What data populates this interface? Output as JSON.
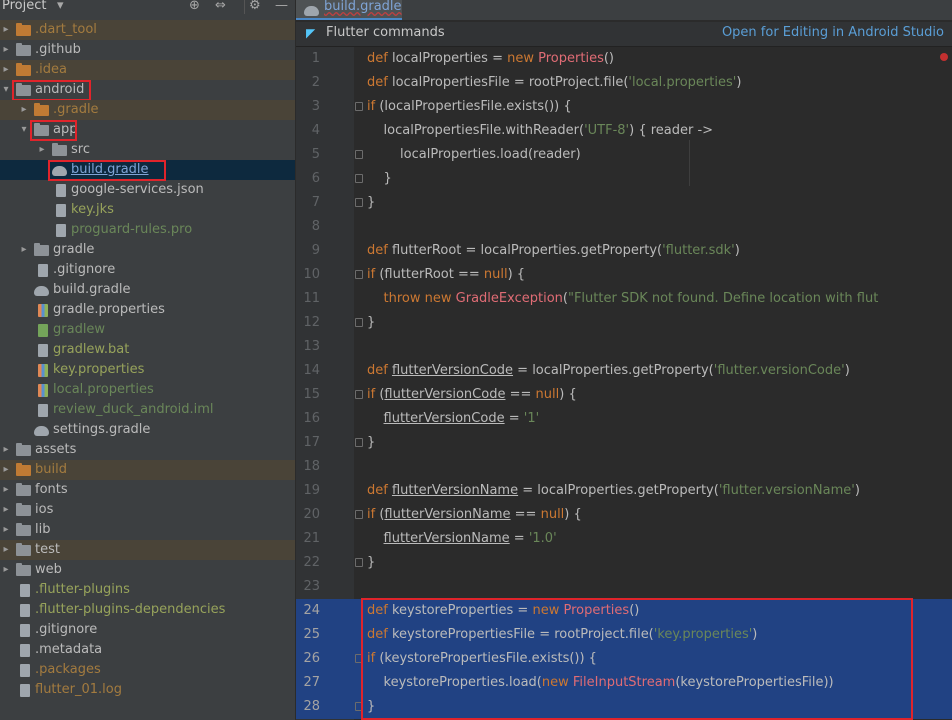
{
  "project_panel": {
    "title": "Project",
    "tree": [
      {
        "label": ".dart_tool",
        "kind": "folder",
        "arrow": true,
        "indent": 0,
        "color": "orange",
        "bg": "ignored"
      },
      {
        "label": ".github",
        "kind": "folder",
        "arrow": true,
        "indent": 0,
        "color": "default"
      },
      {
        "label": ".idea",
        "kind": "folder",
        "arrow": true,
        "indent": 0,
        "color": "orange",
        "bg": "ignored"
      },
      {
        "label": "android",
        "kind": "folder",
        "arrow": true,
        "expanded": true,
        "indent": 0,
        "color": "default",
        "boxed": true
      },
      {
        "label": ".gradle",
        "kind": "folder",
        "arrow": true,
        "indent": 1,
        "color": "orange",
        "bg": "ignored"
      },
      {
        "label": "app",
        "kind": "folder",
        "arrow": true,
        "expanded": true,
        "indent": 1,
        "color": "default",
        "boxed": true
      },
      {
        "label": "src",
        "kind": "folder",
        "arrow": true,
        "indent": 2,
        "color": "default"
      },
      {
        "label": "build.gradle",
        "kind": "gradle",
        "indent": 2,
        "color": "link",
        "selected": true,
        "boxed": true
      },
      {
        "label": "google-services.json",
        "kind": "file",
        "indent": 2,
        "color": "default"
      },
      {
        "label": "key.jks",
        "kind": "file",
        "indent": 2,
        "color": "olive"
      },
      {
        "label": "proguard-rules.pro",
        "kind": "file",
        "indent": 2,
        "color": "green"
      },
      {
        "label": "gradle",
        "kind": "folder",
        "arrow": true,
        "indent": 1,
        "color": "default"
      },
      {
        "label": ".gitignore",
        "kind": "file",
        "indent": 1,
        "color": "default"
      },
      {
        "label": "build.gradle",
        "kind": "gradle",
        "indent": 1,
        "color": "default"
      },
      {
        "label": "gradle.properties",
        "kind": "file-bar",
        "indent": 1,
        "color": "default"
      },
      {
        "label": "gradlew",
        "kind": "file-green",
        "indent": 1,
        "color": "green"
      },
      {
        "label": "gradlew.bat",
        "kind": "file",
        "indent": 1,
        "color": "olive"
      },
      {
        "label": "key.properties",
        "kind": "file-bar",
        "indent": 1,
        "color": "olive"
      },
      {
        "label": "local.properties",
        "kind": "file-bar",
        "indent": 1,
        "color": "green"
      },
      {
        "label": "review_duck_android.iml",
        "kind": "file",
        "indent": 1,
        "color": "green"
      },
      {
        "label": "settings.gradle",
        "kind": "gradle",
        "indent": 1,
        "color": "default"
      },
      {
        "label": "assets",
        "kind": "folder",
        "arrow": true,
        "indent": 0,
        "color": "default"
      },
      {
        "label": "build",
        "kind": "folder-orange",
        "arrow": true,
        "indent": 0,
        "color": "orange",
        "bg": "ignored"
      },
      {
        "label": "fonts",
        "kind": "folder",
        "arrow": true,
        "indent": 0,
        "color": "default"
      },
      {
        "label": "ios",
        "kind": "folder",
        "arrow": true,
        "indent": 0,
        "color": "default"
      },
      {
        "label": "lib",
        "kind": "folder",
        "arrow": true,
        "indent": 0,
        "color": "default"
      },
      {
        "label": "test",
        "kind": "folder",
        "arrow": true,
        "indent": 0,
        "color": "default",
        "bg": "ignored"
      },
      {
        "label": "web",
        "kind": "folder",
        "arrow": true,
        "indent": 0,
        "color": "default"
      },
      {
        "label": ".flutter-plugins",
        "kind": "file",
        "indent": 0,
        "color": "olive"
      },
      {
        "label": ".flutter-plugins-dependencies",
        "kind": "file",
        "indent": 0,
        "color": "olive"
      },
      {
        "label": ".gitignore",
        "kind": "file",
        "indent": 0,
        "color": "default"
      },
      {
        "label": ".metadata",
        "kind": "file",
        "indent": 0,
        "color": "default"
      },
      {
        "label": ".packages",
        "kind": "file",
        "indent": 0,
        "color": "orange"
      },
      {
        "label": "flutter_01.log",
        "kind": "file",
        "indent": 0,
        "color": "orange"
      }
    ]
  },
  "editor": {
    "tab_label": "build.gradle",
    "flutter_bar": {
      "label": "Flutter commands",
      "action": "Open for Editing in Android Studio"
    },
    "lines": [
      {
        "n": "1",
        "fold": false,
        "tokens": [
          [
            "kw",
            "def "
          ],
          [
            "plain",
            "localProperties = "
          ],
          [
            "kw",
            "new "
          ],
          [
            "cls",
            "Properties"
          ],
          [
            "plain",
            "()"
          ]
        ]
      },
      {
        "n": "2",
        "fold": false,
        "tokens": [
          [
            "kw",
            "def "
          ],
          [
            "plain",
            "localPropertiesFile = rootProject.file("
          ],
          [
            "str",
            "'local.properties'"
          ],
          [
            "plain",
            ")"
          ]
        ]
      },
      {
        "n": "3",
        "fold": true,
        "tokens": [
          [
            "kw",
            "if "
          ],
          [
            "plain",
            "(localPropertiesFile.exists()) {"
          ]
        ]
      },
      {
        "n": "4",
        "fold": false,
        "tokens": [
          [
            "plain",
            "    localPropertiesFile.withReader("
          ],
          [
            "str",
            "'UTF-8'"
          ],
          [
            "plain",
            ") { reader ->"
          ]
        ]
      },
      {
        "n": "5",
        "fold": true,
        "tokens": [
          [
            "plain",
            "        localProperties.load(reader)"
          ]
        ]
      },
      {
        "n": "6",
        "fold": true,
        "tokens": [
          [
            "plain",
            "    }"
          ]
        ]
      },
      {
        "n": "7",
        "fold": true,
        "tokens": [
          [
            "plain",
            "}"
          ]
        ]
      },
      {
        "n": "8",
        "fold": false,
        "tokens": []
      },
      {
        "n": "9",
        "fold": false,
        "tokens": [
          [
            "kw",
            "def "
          ],
          [
            "plain",
            "flutterRoot = localProperties.getProperty("
          ],
          [
            "str",
            "'flutter.sdk'"
          ],
          [
            "plain",
            ")"
          ]
        ]
      },
      {
        "n": "10",
        "fold": true,
        "tokens": [
          [
            "kw",
            "if "
          ],
          [
            "plain",
            "(flutterRoot == "
          ],
          [
            "kw",
            "null"
          ],
          [
            "plain",
            ") {"
          ]
        ]
      },
      {
        "n": "11",
        "fold": false,
        "tokens": [
          [
            "plain",
            "    "
          ],
          [
            "kw",
            "throw new "
          ],
          [
            "cls",
            "GradleException"
          ],
          [
            "plain",
            "("
          ],
          [
            "dstr",
            "\"Flutter SDK not found. Define location with flut"
          ]
        ]
      },
      {
        "n": "12",
        "fold": true,
        "tokens": [
          [
            "plain",
            "}"
          ]
        ]
      },
      {
        "n": "13",
        "fold": false,
        "tokens": []
      },
      {
        "n": "14",
        "fold": false,
        "tokens": [
          [
            "kw",
            "def "
          ],
          [
            "prop",
            "flutterVersionCode"
          ],
          [
            "plain",
            " = localProperties.getProperty("
          ],
          [
            "str",
            "'flutter.versionCode'"
          ],
          [
            "plain",
            ")"
          ]
        ]
      },
      {
        "n": "15",
        "fold": true,
        "tokens": [
          [
            "kw",
            "if "
          ],
          [
            "plain",
            "("
          ],
          [
            "prop",
            "flutterVersionCode"
          ],
          [
            "plain",
            " == "
          ],
          [
            "kw",
            "null"
          ],
          [
            "plain",
            ") {"
          ]
        ]
      },
      {
        "n": "16",
        "fold": false,
        "tokens": [
          [
            "plain",
            "    "
          ],
          [
            "prop",
            "flutterVersionCode"
          ],
          [
            "plain",
            " = "
          ],
          [
            "str",
            "'1'"
          ]
        ]
      },
      {
        "n": "17",
        "fold": true,
        "tokens": [
          [
            "plain",
            "}"
          ]
        ]
      },
      {
        "n": "18",
        "fold": false,
        "tokens": []
      },
      {
        "n": "19",
        "fold": false,
        "tokens": [
          [
            "kw",
            "def "
          ],
          [
            "prop",
            "flutterVersionName"
          ],
          [
            "plain",
            " = localProperties.getProperty("
          ],
          [
            "str",
            "'flutter.versionName'"
          ],
          [
            "plain",
            ")"
          ]
        ]
      },
      {
        "n": "20",
        "fold": true,
        "tokens": [
          [
            "kw",
            "if "
          ],
          [
            "plain",
            "("
          ],
          [
            "prop",
            "flutterVersionName"
          ],
          [
            "plain",
            " == "
          ],
          [
            "kw",
            "null"
          ],
          [
            "plain",
            ") {"
          ]
        ]
      },
      {
        "n": "21",
        "fold": false,
        "tokens": [
          [
            "plain",
            "    "
          ],
          [
            "prop",
            "flutterVersionName"
          ],
          [
            "plain",
            " = "
          ],
          [
            "str",
            "'1.0'"
          ]
        ]
      },
      {
        "n": "22",
        "fold": true,
        "tokens": [
          [
            "plain",
            "}"
          ]
        ]
      },
      {
        "n": "23",
        "fold": false,
        "tokens": []
      },
      {
        "n": "24",
        "fold": false,
        "hl": true,
        "tokens": [
          [
            "kw",
            "def "
          ],
          [
            "plain",
            "keystoreProperties = "
          ],
          [
            "kw",
            "new "
          ],
          [
            "cls",
            "Properties"
          ],
          [
            "plain",
            "()"
          ]
        ]
      },
      {
        "n": "25",
        "fold": false,
        "hl": true,
        "tokens": [
          [
            "kw",
            "def "
          ],
          [
            "plain",
            "keystorePropertiesFile = rootProject.file("
          ],
          [
            "str",
            "'key.properties'"
          ],
          [
            "plain",
            ")"
          ]
        ]
      },
      {
        "n": "26",
        "fold": true,
        "hl": true,
        "tokens": [
          [
            "kw",
            "if "
          ],
          [
            "plain",
            "(keystorePropertiesFile.exists()) {"
          ]
        ]
      },
      {
        "n": "27",
        "fold": false,
        "hl": true,
        "tokens": [
          [
            "plain",
            "    keystoreProperties.load("
          ],
          [
            "kw",
            "new "
          ],
          [
            "cls",
            "FileInputStream"
          ],
          [
            "plain",
            "(keystorePropertiesFile))"
          ]
        ]
      },
      {
        "n": "28",
        "fold": true,
        "hl": true,
        "tokens": [
          [
            "plain",
            "}"
          ]
        ]
      }
    ]
  }
}
